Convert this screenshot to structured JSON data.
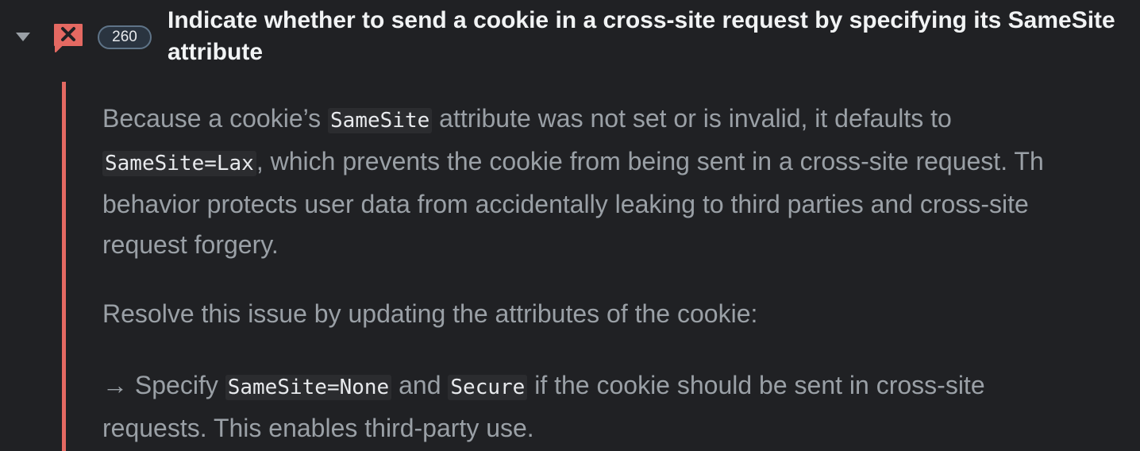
{
  "issue": {
    "icon": "error-speech-bubble-icon",
    "count": "260",
    "title": "Indicate whether to send a cookie in a cross-site request by specifying its SameSite attribute",
    "colors": {
      "accent_red": "#e46962",
      "background": "#202124"
    }
  },
  "body": {
    "p1": {
      "t1": "Because a cookie’s ",
      "c1": "SameSite",
      "t2": " attribute was not set or is invalid, it defaults to",
      "c2": "SameSite=Lax",
      "t3": ", which prevents the cookie from being sent in a cross-site request. Th",
      "t4": "behavior protects user data from accidentally leaking to third parties and cross-site",
      "t5": "request forgery."
    },
    "p2": "Resolve this issue by updating the attributes of the cookie:",
    "p3": {
      "arrow": "→",
      "t1": " Specify ",
      "c1": "SameSite=None",
      "t2": " and ",
      "c2": "Secure",
      "t3": " if the cookie should be sent in cross-site",
      "t4": "requests. This enables third-party use."
    }
  }
}
